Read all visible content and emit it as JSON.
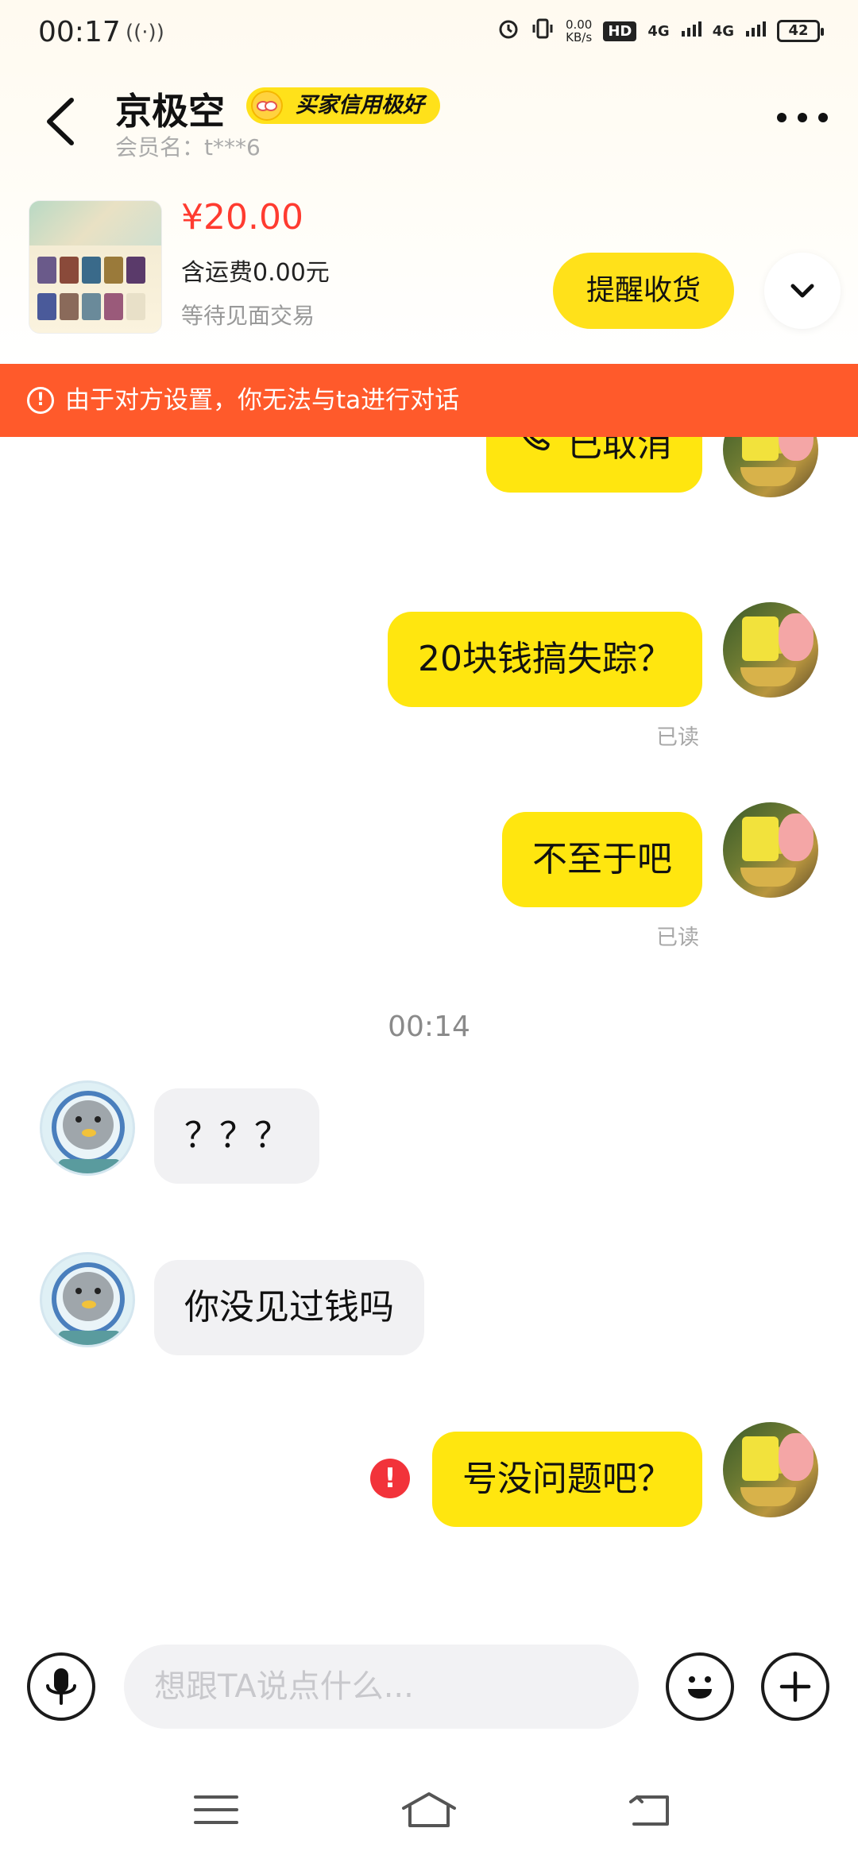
{
  "status_bar": {
    "time": "00:17",
    "speed_value": "0.00",
    "speed_unit": "KB/s",
    "hd": "HD",
    "net1": "4G",
    "net2": "4G",
    "battery": "42"
  },
  "header": {
    "title": "京极空",
    "badge": "买家信用极好",
    "member": "会员名：t***6"
  },
  "product": {
    "price": "¥20.00",
    "shipping": "含运费0.00元",
    "status": "等待见面交易",
    "remind_button": "提醒收货"
  },
  "banner": {
    "text": "由于对方设置，你无法与ta进行对话"
  },
  "messages": {
    "m1": "已取消",
    "m2": "20块钱搞失踪？",
    "m2_status": "已读",
    "m3": "不至于吧",
    "m3_status": "已读",
    "time": "00:14",
    "m4": "？？？",
    "m5": "你没见过钱吗",
    "m6": "号没问题吧？"
  },
  "input": {
    "placeholder": "想跟TA说点什么..."
  },
  "icons": {
    "back": "back-arrow-icon",
    "more": "more-dots-icon",
    "expand": "chevron-down-icon",
    "warning": "warning-circle-icon",
    "phone": "phone-call-icon",
    "error": "send-failed-icon",
    "mic": "microphone-icon",
    "emoji": "emoji-icon",
    "plus": "plus-icon",
    "menu": "menu-icon",
    "home": "home-icon",
    "nav_back": "nav-back-icon"
  },
  "colors": {
    "accent_yellow": "#ffe60f",
    "banner_orange": "#ff5a2b",
    "price_red": "#ff3b30",
    "error_red": "#f2333a"
  }
}
